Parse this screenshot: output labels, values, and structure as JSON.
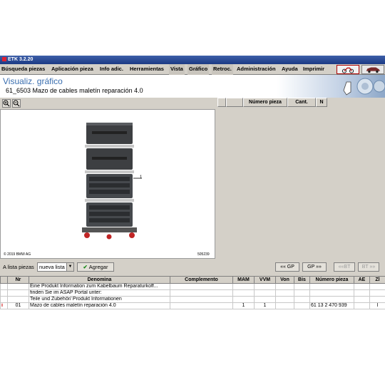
{
  "window": {
    "title": "ETK 3.2.20"
  },
  "menu": [
    {
      "label": "Búsqueda piezas",
      "active": false
    },
    {
      "label": "Aplicación pieza",
      "active": false
    },
    {
      "label": "Info adic.",
      "active": false
    },
    {
      "label": "Herramientas",
      "active": false
    },
    {
      "label": "Vista",
      "active": true
    },
    {
      "label": "Gráfico",
      "active": true
    },
    {
      "label": "Retroc.",
      "active": true
    },
    {
      "label": "Administración",
      "active": false
    },
    {
      "label": "Ayuda",
      "active": false
    },
    {
      "label": "Imprimir",
      "active": false
    }
  ],
  "brand_buttons": [
    {
      "icon": "motorcycle-icon"
    },
    {
      "icon": "car-icon"
    }
  ],
  "header": {
    "title": "Visualiz. gráfico",
    "subtitle": "61_6503 Mazo de cables maletín reparación 4.0"
  },
  "zoom": {
    "zoom_in_icon": "zoom-in-icon",
    "zoom_out_icon": "zoom-out-icon"
  },
  "image_panel": {
    "copyright": "© 2019 BMW AG",
    "image_id": "505239",
    "callout": "1"
  },
  "right_table": {
    "columns": [
      "Número pieza",
      "Cant.",
      "N"
    ]
  },
  "add_bar": {
    "label": "A lista piezas",
    "select_value": "nueva lista",
    "add_button": "Agregar",
    "gp_prev": "«« GP",
    "gp_next": "GP »»",
    "bt_prev": "««BT",
    "bt_next": "BT »»"
  },
  "parts_table": {
    "columns": [
      "",
      "Nr",
      "Denomina",
      "Complemento",
      "MAM",
      "VVM",
      "Von",
      "Bis",
      "Número pieza",
      "AE",
      "Zl"
    ],
    "rows": [
      [
        "",
        "",
        "Eine Produkt Information zum Kabelbaum Reparaturkoff...",
        "",
        "",
        "",
        "",
        "",
        "",
        "",
        ""
      ],
      [
        "",
        "",
        "finden Sie im ASAP Portal unter:",
        "",
        "",
        "",
        "",
        "",
        "",
        "",
        ""
      ],
      [
        "",
        "",
        "Teile und Zubehör/ Produkt Informationen",
        "",
        "",
        "",
        "",
        "",
        "",
        "",
        ""
      ],
      [
        "i",
        "01",
        "Mazo de cables maletín reparación 4.0",
        "",
        "1",
        "1",
        "",
        "",
        "61 13 2 470 939",
        "",
        "I"
      ]
    ]
  },
  "colors": {
    "accent_blue": "#3a6eaf",
    "titlebar": "#1c3a84",
    "info_red": "#cc0000"
  }
}
